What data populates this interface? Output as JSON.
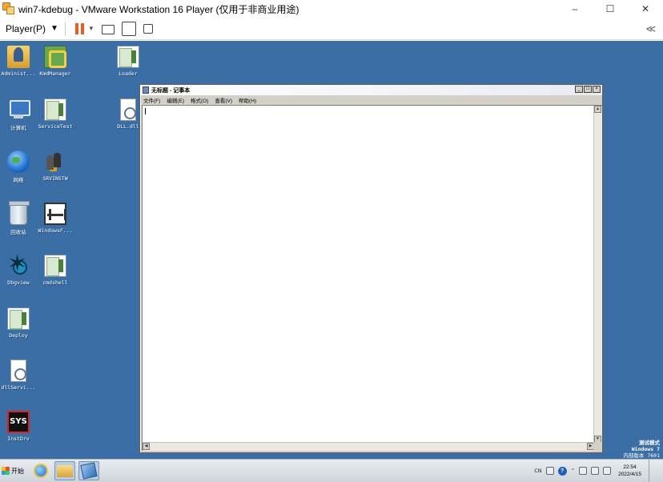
{
  "host": {
    "title": "win7-kdebug - VMware Workstation 16 Player (仅用于非商业用途)",
    "controls": {
      "minimize": "–",
      "maximize": "☐",
      "close": "✕"
    },
    "toolbar": {
      "player_menu": "Player(P)",
      "player_caret": "▼",
      "collapse": "≪"
    }
  },
  "desktop": {
    "icons": [
      {
        "label": "Administ...",
        "icon": "user-folder-icon"
      },
      {
        "label": "KmdManager",
        "icon": "kmdmanager-icon"
      },
      {
        "label": "Loader",
        "icon": "app-icon"
      },
      {
        "label": "计算机",
        "icon": "computer-icon"
      },
      {
        "label": "ServiceTest",
        "icon": "app-icon"
      },
      {
        "label": "DLL.dll",
        "icon": "dll-file-icon"
      },
      {
        "label": "网络",
        "icon": "network-icon"
      },
      {
        "label": "SRVINSTW",
        "icon": "srvinstw-icon"
      },
      {
        "label": "回收站",
        "icon": "recycle-bin-icon"
      },
      {
        "label": "WindowsF...",
        "icon": "windowsf-icon"
      },
      {
        "label": "Dbgview",
        "icon": "dbgview-icon"
      },
      {
        "label": "cmdshell",
        "icon": "app-icon"
      },
      {
        "label": "Deploy",
        "icon": "app-icon"
      },
      {
        "label": "dllServi...",
        "icon": "dll-file-icon"
      },
      {
        "label": "InstDrv",
        "icon": "instdrv-icon",
        "badge": "SYS"
      }
    ],
    "watermark": {
      "line1": "测试模式",
      "line2": "Windows 7",
      "line3": "内部版本 7601"
    }
  },
  "notepad": {
    "title": "无标题 - 记事本",
    "controls": {
      "minimize": "_",
      "maximize": "□",
      "close": "×"
    },
    "menu": [
      "文件(F)",
      "编辑(E)",
      "格式(O)",
      "查看(V)",
      "帮助(H)"
    ],
    "content": ""
  },
  "taskbar": {
    "start_label": "开始",
    "tray": {
      "lang": "CN",
      "time": "22:54",
      "date": "2022/4/15"
    }
  },
  "colors": {
    "desktop_bg": "#3a6ea5",
    "pause_accent": "#e85b25"
  }
}
